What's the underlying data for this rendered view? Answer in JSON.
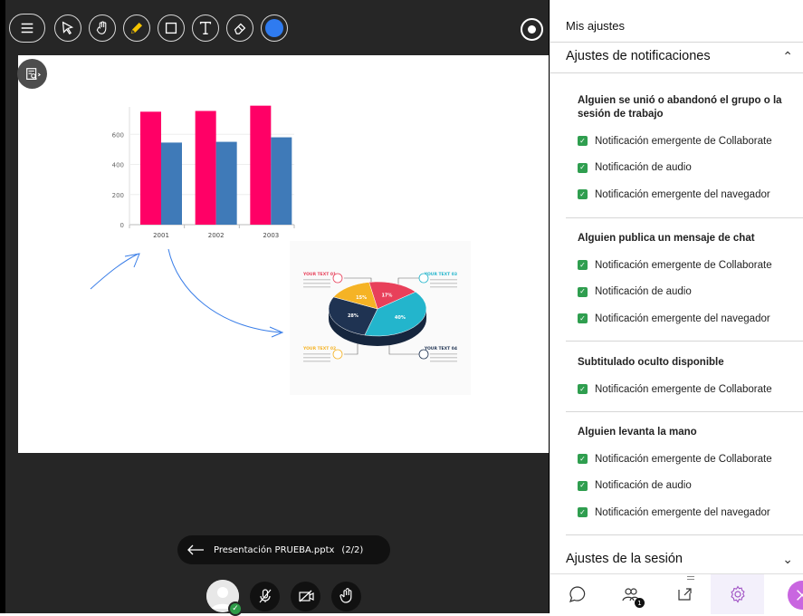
{
  "stage": {
    "presentation_name": "Presentación PRUEBA.pptx",
    "slide_counter": "(2/2)"
  },
  "chart_data": [
    {
      "type": "bar",
      "categories": [
        "2001",
        "2002",
        "2003"
      ],
      "series": [
        {
          "values": [
            750,
            755,
            790
          ],
          "color": "#ff0066"
        },
        {
          "values": [
            545,
            550,
            580
          ],
          "color": "#3f7ab8"
        }
      ],
      "yticks": [
        "0",
        "200",
        "400",
        "600"
      ],
      "ylim": [
        0,
        800
      ]
    },
    {
      "type": "pie",
      "slice_labels": [
        "17%",
        "15%",
        "40%",
        "28%"
      ],
      "callouts": [
        "YOUR TEXT 01",
        "YOUR TEXT 02",
        "YOUR TEXT 03",
        "YOUR TEXT 04"
      ],
      "colors": [
        "#e8405a",
        "#f5b325",
        "#23b5cc",
        "#1f3352"
      ]
    }
  ],
  "panel": {
    "title": "Mis ajustes",
    "notif_header": "Ajustes de notificaciones",
    "session_header": "Ajustes de la sesión",
    "groups": [
      {
        "title": "Alguien se unió o abandonó el grupo o la sesión de trabajo",
        "options": [
          "Notificación emergente de Collaborate",
          "Notificación de audio",
          "Notificación emergente del navegador"
        ]
      },
      {
        "title": "Alguien publica un mensaje de chat",
        "options": [
          "Notificación emergente de Collaborate",
          "Notificación de audio",
          "Notificación emergente del navegador"
        ]
      },
      {
        "title": "Subtitulado oculto disponible",
        "options": [
          "Notificación emergente de Collaborate"
        ]
      },
      {
        "title": "Alguien levanta la mano",
        "options": [
          "Notificación emergente de Collaborate",
          "Notificación de audio",
          "Notificación emergente del navegador"
        ]
      }
    ],
    "attendee_badge": "1"
  },
  "colors": {
    "accent_purple": "#c966e0",
    "check_green": "#2f9e4f",
    "stage_bg": "#262626"
  }
}
